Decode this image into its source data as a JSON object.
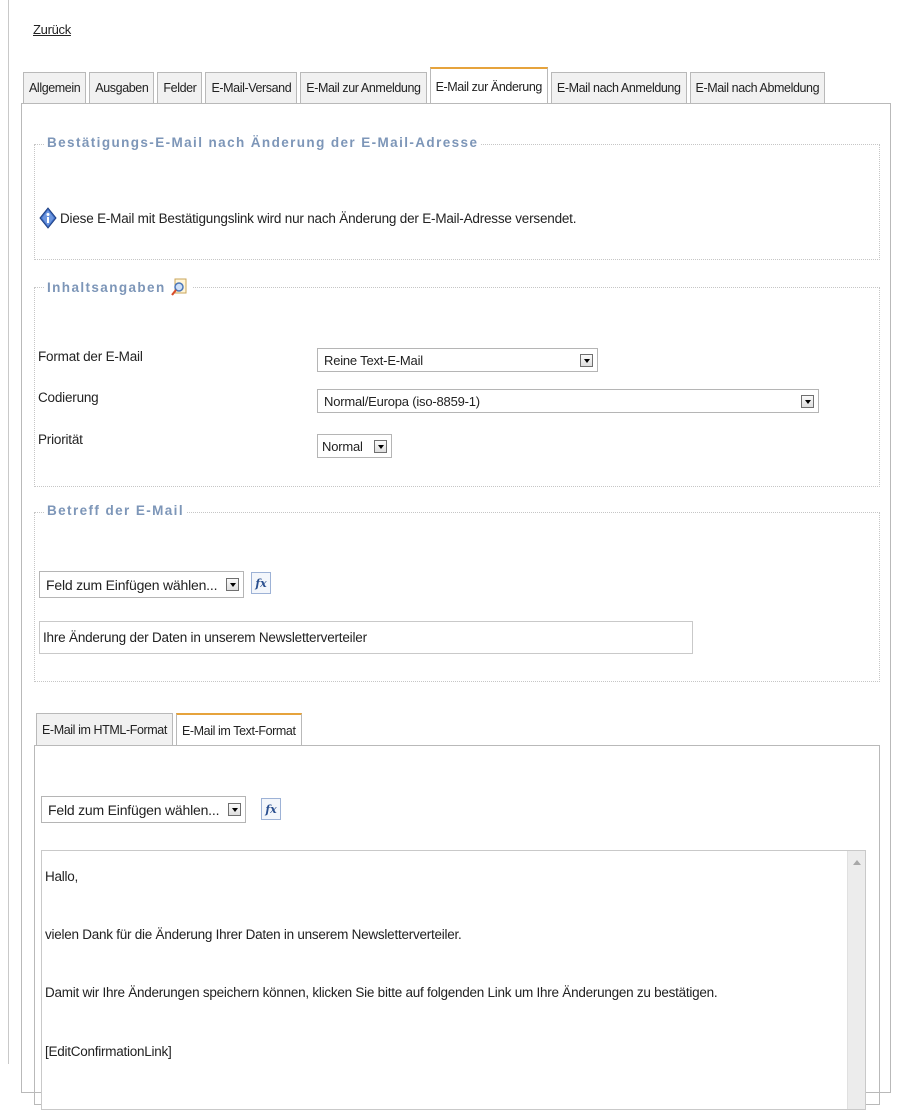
{
  "back_link": "Zurück",
  "tabs": [
    {
      "label": "Allgemein",
      "active": false
    },
    {
      "label": "Ausgaben",
      "active": false
    },
    {
      "label": "Felder",
      "active": false
    },
    {
      "label": "E-Mail-Versand",
      "active": false
    },
    {
      "label": "E-Mail zur Anmeldung",
      "active": false
    },
    {
      "label": "E-Mail zur Änderung",
      "active": true
    },
    {
      "label": "E-Mail nach Anmeldung",
      "active": false
    },
    {
      "label": "E-Mail nach Abmeldung",
      "active": false
    }
  ],
  "confirmation": {
    "legend": "Bestätigungs-E-Mail nach Änderung der E-Mail-Adresse",
    "info_icon": "info-diamond-icon",
    "info_text": "Diese E-Mail mit Bestätigungslink wird nur nach Änderung der E-Mail-Adresse versendet."
  },
  "content": {
    "legend": "Inhaltsangaben",
    "legend_icon": "help-magnifier-icon",
    "format_label": "Format der E-Mail",
    "format_value": "Reine Text-E-Mail",
    "encoding_label": "Codierung",
    "encoding_value": "Normal/Europa (iso-8859-1)",
    "priority_label": "Priorität",
    "priority_value": "Normal"
  },
  "subject": {
    "legend": "Betreff der E-Mail",
    "field_select": "Feld zum Einfügen wählen...",
    "fx_label": "fx",
    "value": "Ihre Änderung der Daten in unserem Newsletterverteiler"
  },
  "mail_tabs": [
    {
      "label": "E-Mail im HTML-Format",
      "active": false
    },
    {
      "label": "E-Mail im Text-Format",
      "active": true
    }
  ],
  "body_editor": {
    "field_select": "Feld zum Einfügen wählen...",
    "fx_label": "fx",
    "lines": [
      "Hallo,",
      "vielen Dank für die Änderung Ihrer Daten in unserem Newsletterverteiler.",
      "Damit wir Ihre Änderungen speichern können, klicken Sie bitte auf folgenden Link um Ihre Änderungen zu bestätigen.",
      "[EditConfirmationLink]"
    ]
  },
  "colors": {
    "legend_text": "#7d96b8",
    "active_tab_accent": "#e6a33c"
  }
}
